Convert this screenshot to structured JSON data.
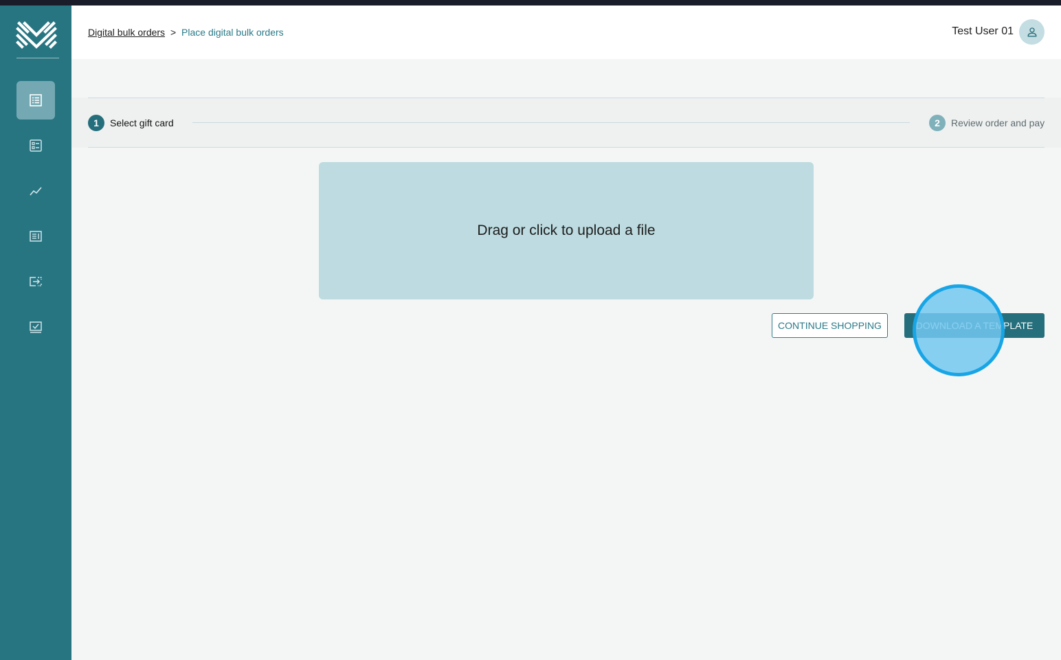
{
  "header": {
    "breadcrumb": {
      "parent": "Digital bulk orders",
      "separator": ">",
      "current": "Place digital bulk orders"
    },
    "user_name": "Test User 01",
    "avatar_icon": "user-icon"
  },
  "sidebar": {
    "logo_icon": "brand-logo",
    "items": [
      {
        "icon": "list-icon",
        "active": true
      },
      {
        "icon": "checklist-icon",
        "active": false
      },
      {
        "icon": "trend-chart-icon",
        "active": false
      },
      {
        "icon": "document-icon",
        "active": false
      },
      {
        "icon": "transfer-icon",
        "active": false
      },
      {
        "icon": "monitor-check-icon",
        "active": false
      }
    ]
  },
  "stepper": {
    "steps": [
      {
        "number": "1",
        "label": "Select gift card",
        "active": true
      },
      {
        "number": "2",
        "label": "Review order and pay",
        "active": false
      }
    ]
  },
  "upload": {
    "prompt": "Drag or click to upload a file"
  },
  "actions": {
    "continue_label": "CONTINUE SHOPPING",
    "download_label": "DOWNLOAD A TEMPLATE"
  },
  "colors": {
    "sidebar": "#287582",
    "accent": "#256f7d",
    "upload_zone": "#bddbe0",
    "click_indicator": "#18a5e6"
  }
}
